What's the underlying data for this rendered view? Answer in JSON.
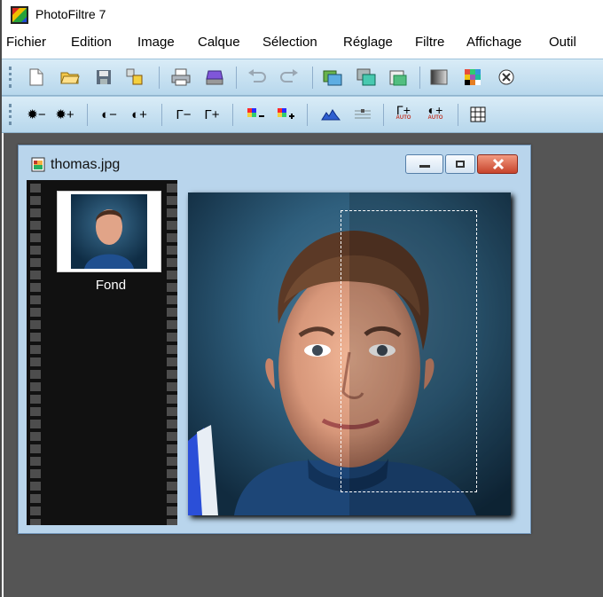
{
  "app": {
    "title": "PhotoFiltre 7"
  },
  "menu": [
    {
      "label": "Fichier"
    },
    {
      "label": "Edition"
    },
    {
      "label": "Image"
    },
    {
      "label": "Calque"
    },
    {
      "label": "Sélection"
    },
    {
      "label": "Réglage"
    },
    {
      "label": "Filtre"
    },
    {
      "label": "Affichage"
    },
    {
      "label": "Outil"
    }
  ],
  "toolbar1": {
    "icons": [
      "new-document-icon",
      "open-folder-icon",
      "save-disk-icon",
      "filter-tools-icon",
      "print-icon",
      "scanner-icon",
      "undo-icon",
      "redo-icon",
      "image-layer-icon",
      "image-copy-icon",
      "image-paste-icon",
      "gradient-icon",
      "color-palette-icon",
      "effects-icon"
    ]
  },
  "toolbar2": {
    "icons": [
      "brightness-minus-icon",
      "brightness-plus-icon",
      "contrast-minus-icon",
      "contrast-plus-icon",
      "gamma-minus-icon",
      "gamma-plus-icon",
      "saturation-minus-icon",
      "saturation-plus-icon",
      "levels-icon",
      "curves-icon",
      "gamma-auto-icon",
      "contrast-auto-icon",
      "grid-icon"
    ],
    "auto_label": "AUTO"
  },
  "document": {
    "filename": "thomas.jpg",
    "layer_name": "Fond"
  },
  "colors": {
    "toolbar_bg": "#cfe6f5",
    "workspace": "#555555",
    "window_frame": "#b9d5ec",
    "close_button": "#c7442c"
  }
}
